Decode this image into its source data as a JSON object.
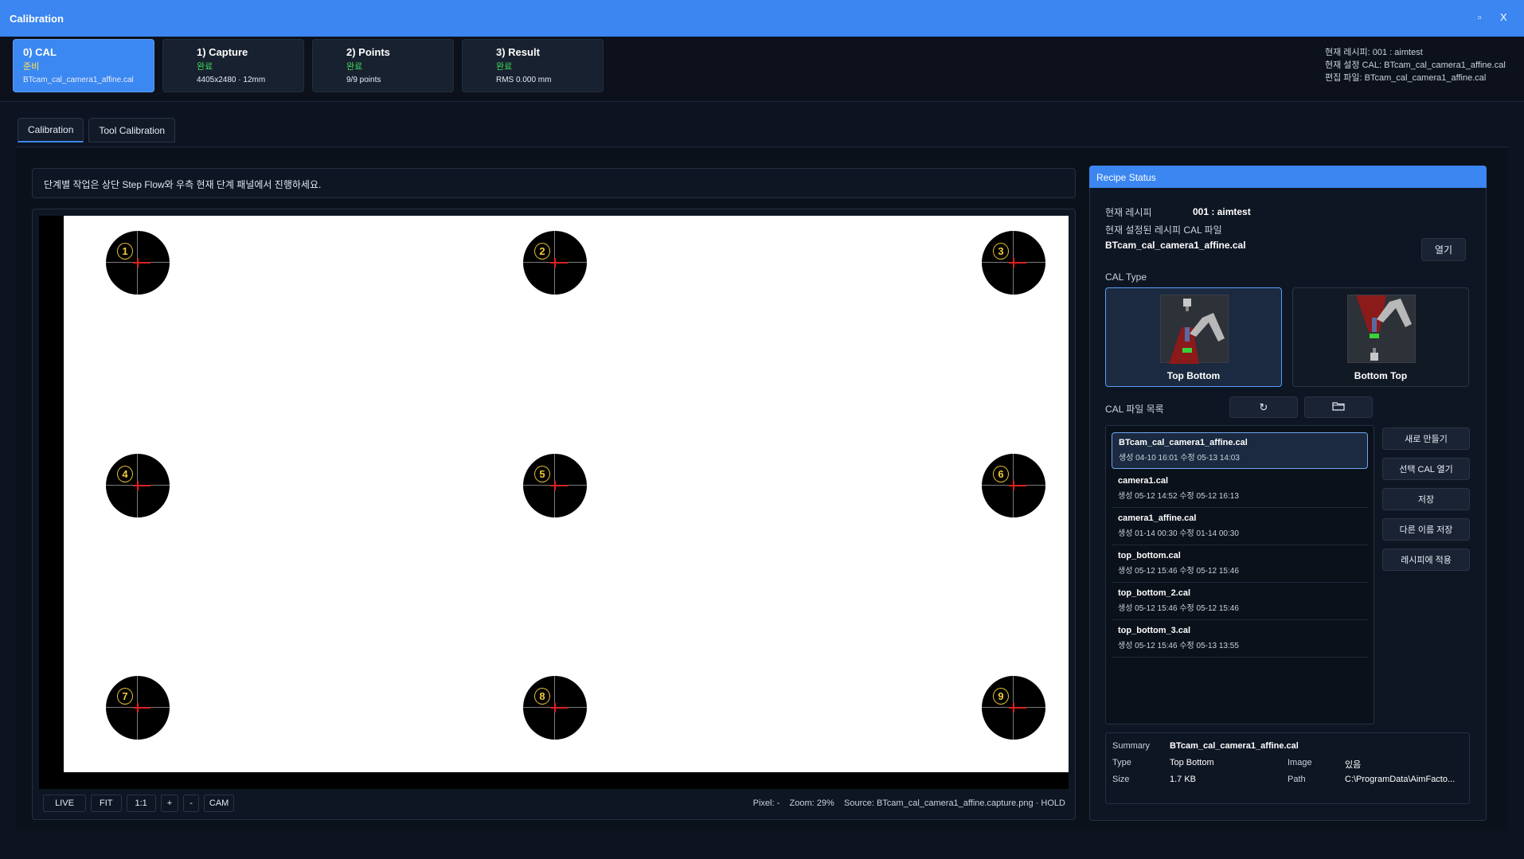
{
  "window": {
    "title": "Calibration",
    "maximize": "▫",
    "close": "X"
  },
  "steps": [
    {
      "title": "0) CAL",
      "status": "준비",
      "detail": "BTcam_cal_camera1_affine.cal"
    },
    {
      "title": "1) Capture",
      "status": "완료",
      "detail": "4405x2480 · 12mm"
    },
    {
      "title": "2) Points",
      "status": "완료",
      "detail": "9/9 points"
    },
    {
      "title": "3) Result",
      "status": "완료",
      "detail": "RMS 0.000 mm"
    }
  ],
  "header_info": {
    "recipe": "현재 레시피: 001 : aimtest",
    "cal": "현재 설정 CAL: BTcam_cal_camera1_affine.cal",
    "edit": "편집 파일: BTcam_cal_camera1_affine.cal"
  },
  "tabs": [
    "Calibration",
    "Tool Calibration"
  ],
  "notice": "단계별 작업은 상단 Step Flow와 우측 현재 단계 패널에서 진행하세요.",
  "targets": [
    "1",
    "2",
    "3",
    "4",
    "5",
    "6",
    "7",
    "8",
    "9"
  ],
  "viewer_tools": [
    "LIVE",
    "FIT",
    "1:1",
    "+",
    "-",
    "CAM"
  ],
  "viewer_status": {
    "pixel": "Pixel:  -",
    "zoom": "Zoom:  29%",
    "source": "Source:  BTcam_cal_camera1_affine.capture.png · HOLD"
  },
  "recipe_panel": {
    "title": "Recipe Status",
    "current_recipe_label": "현재 레시피",
    "current_recipe_value": "001 : aimtest",
    "cal_file_label": "현재 설정된 레시피 CAL 파일",
    "cal_file_value": "BTcam_cal_camera1_affine.cal",
    "open_button": "열기",
    "cal_type_label": "CAL Type",
    "cal_types": [
      "Top Bottom",
      "Bottom Top"
    ],
    "file_list_label": "CAL 파일 목록",
    "refresh_icon": "↻",
    "folder_icon": "folder-icon"
  },
  "files": [
    {
      "name": "BTcam_cal_camera1_affine.cal",
      "dates": "생성 04-10 16:01   수정 05-13 14:03"
    },
    {
      "name": "camera1.cal",
      "dates": "생성 05-12 14:52   수정 05-12 16:13"
    },
    {
      "name": "camera1_affine.cal",
      "dates": "생성 01-14 00:30   수정 01-14 00:30"
    },
    {
      "name": "top_bottom.cal",
      "dates": "생성 05-12 15:46   수정 05-12 15:46"
    },
    {
      "name": "top_bottom_2.cal",
      "dates": "생성 05-12 15:46   수정 05-12 15:46"
    },
    {
      "name": "top_bottom_3.cal",
      "dates": "생성 05-12 15:46   수정 05-13 13:55"
    }
  ],
  "file_actions": [
    "새로 만들기",
    "선택 CAL 열기",
    "저장",
    "다른 이름 저장",
    "레시피에 적용"
  ],
  "summary": {
    "summary_label": "Summary",
    "summary_value": "BTcam_cal_camera1_affine.cal",
    "type_label": "Type",
    "type_value": "Top Bottom",
    "image_label": "Image",
    "image_value": "있음",
    "size_label": "Size",
    "size_value": "1.7 KB",
    "path_label": "Path",
    "path_value": "C:\\ProgramData\\AimFacto..."
  }
}
